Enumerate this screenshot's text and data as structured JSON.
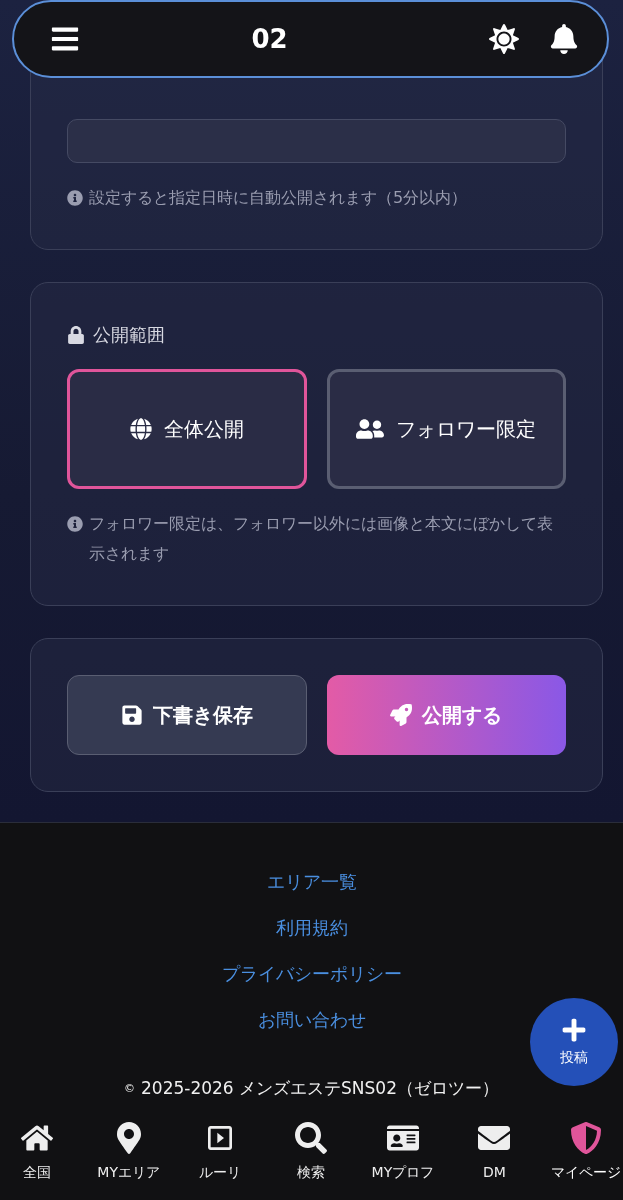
{
  "header": {
    "title": "02"
  },
  "schedule": {
    "hint": "設定すると指定日時に自動公開されます（5分以内）"
  },
  "visibility": {
    "label": "公開範囲",
    "options": [
      {
        "kind": "globe",
        "label": "全体公開",
        "selected": true
      },
      {
        "kind": "users",
        "label": "フォロワー限定",
        "selected": false
      }
    ],
    "hint": "フォロワー限定は、フォロワー以外には画像と本文にぼかして表示されます"
  },
  "actions": [
    {
      "kind": "draft",
      "label": "下書き保存"
    },
    {
      "kind": "publish",
      "label": "公開する"
    }
  ],
  "footer": {
    "links": [
      "エリア一覧",
      "利用規約",
      "プライバシーポリシー",
      "お問い合わせ"
    ],
    "copyright": "2025-2026 メンズエステSNS02（ゼロツー）",
    "copyright_mark": "©"
  },
  "fab": {
    "label": "投稿"
  },
  "nav": [
    {
      "kind": "home",
      "label": "全国",
      "selected": false
    },
    {
      "kind": "pin",
      "label": "MYエリア",
      "selected": false
    },
    {
      "kind": "reel",
      "label": "ルーリ",
      "selected": false
    },
    {
      "kind": "search",
      "label": "検索",
      "selected": false
    },
    {
      "kind": "card",
      "label": "MYプロフ",
      "selected": false
    },
    {
      "kind": "mail",
      "label": "DM",
      "selected": false
    },
    {
      "kind": "shield",
      "label": "マイページ",
      "selected": true
    }
  ]
}
